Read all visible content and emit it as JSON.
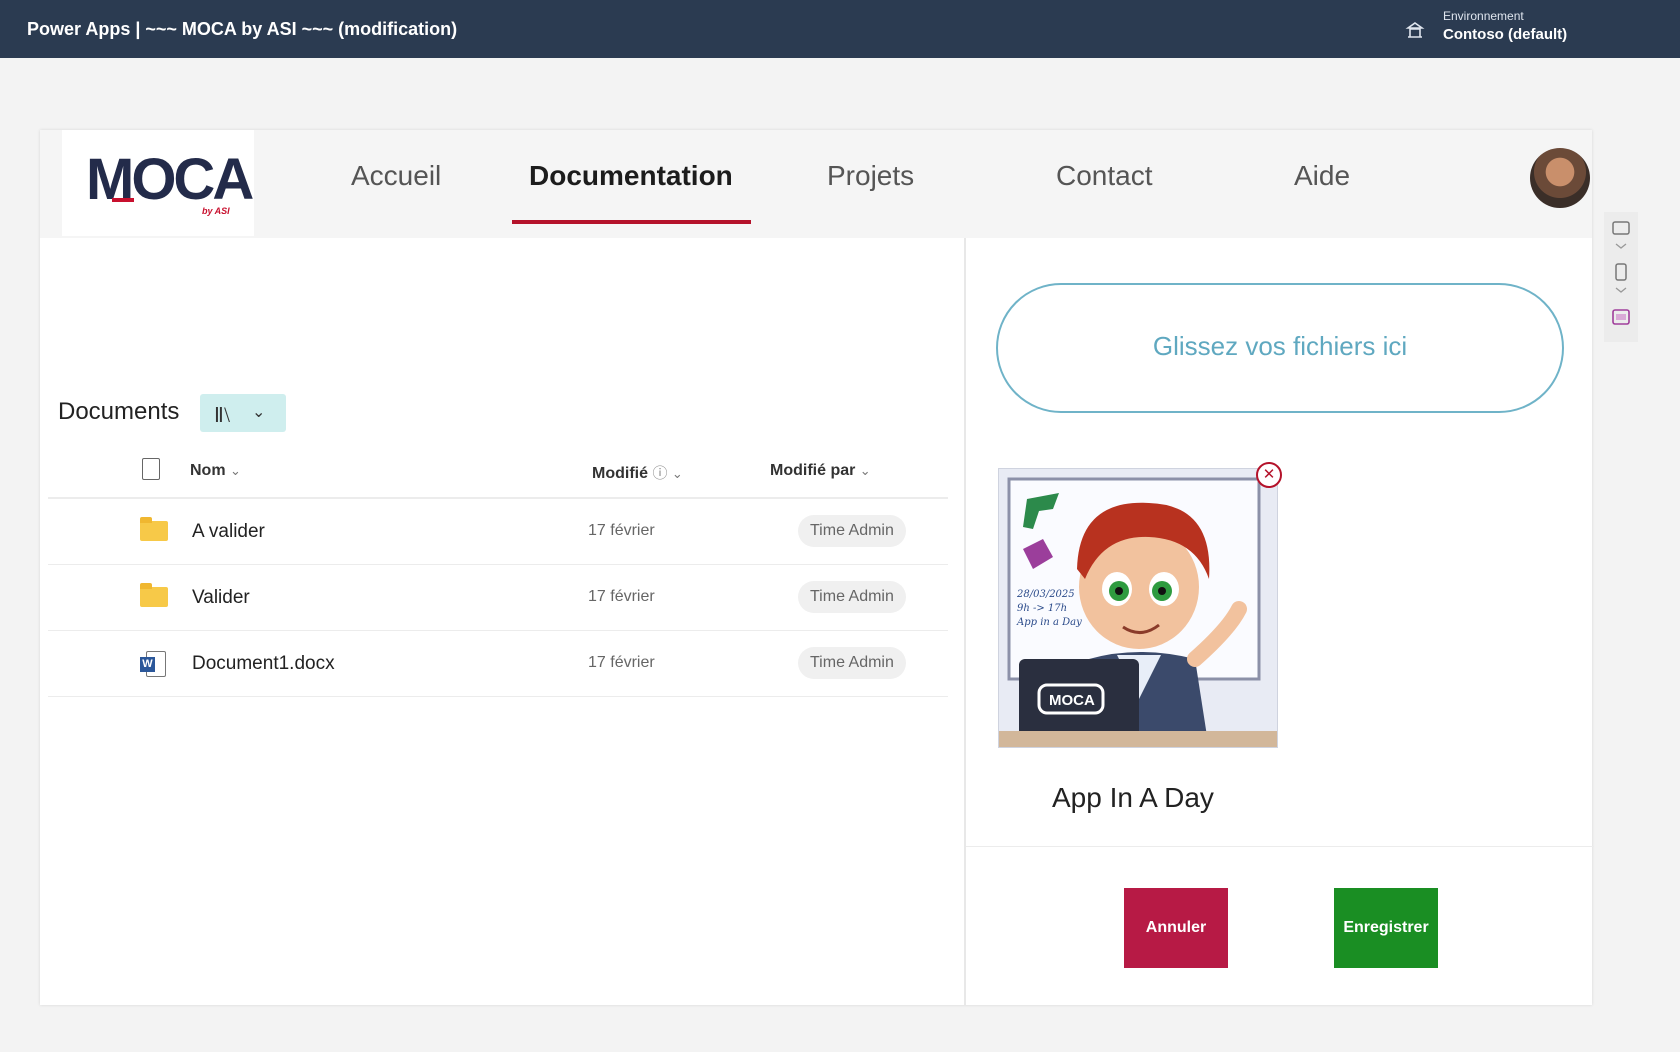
{
  "topbar": {
    "title": "Power Apps  |  ~~~ MOCA by ASI ~~~ (modification)",
    "env_label": "Environnement",
    "env_value": "Contoso (default)"
  },
  "logo": {
    "text": "MOCA",
    "sub": "by ASI"
  },
  "nav": {
    "items": [
      {
        "label": "Accueil",
        "active": false
      },
      {
        "label": "Documentation",
        "active": true
      },
      {
        "label": "Projets",
        "active": false
      },
      {
        "label": "Contact",
        "active": false
      },
      {
        "label": "Aide",
        "active": false
      }
    ]
  },
  "documents": {
    "title": "Documents",
    "columns": {
      "name": "Nom",
      "modified": "Modifié",
      "modified_by": "Modifié par"
    },
    "rows": [
      {
        "type": "folder",
        "name": "A valider",
        "modified": "17 février",
        "modified_by": "Time Admin"
      },
      {
        "type": "folder",
        "name": "Valider",
        "modified": "17 février",
        "modified_by": "Time Admin"
      },
      {
        "type": "docx",
        "name": "Document1.docx",
        "modified": "17 février",
        "modified_by": "Time Admin"
      }
    ]
  },
  "upload": {
    "drop_text": "Glissez vos fichiers ici"
  },
  "card": {
    "title": "App In A Day",
    "image_text": [
      "28/03/2025",
      "9h -> 17h",
      "App in a Day"
    ],
    "laptop_text": "MOCA"
  },
  "actions": {
    "cancel": "Annuler",
    "save": "Enregistrer"
  },
  "colors": {
    "topbar": "#2b3b51",
    "accent": "#b4122a",
    "cancel": "#b71a45",
    "save": "#1a8e23",
    "drop": "#5fa8c0"
  }
}
